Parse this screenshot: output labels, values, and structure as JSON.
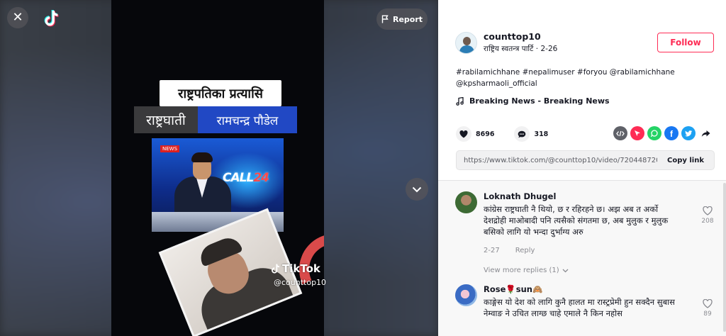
{
  "header": {
    "report_label": "Report"
  },
  "video": {
    "caption_line1": "राष्ट्रपतिका प्रत्यासि",
    "caption_word1": "राष्ट्रघाती",
    "caption_word2": "रामचन्द्र पौडेल",
    "news_call_text": "CALL",
    "news_call_accent": "24",
    "news_channel_chip": "NEWS",
    "watermark_brand": "TikTok",
    "watermark_handle": "@counttop10"
  },
  "author": {
    "username": "counttop10",
    "nickname": "राष्ट्रिय स्वतन्त्र पार्टि",
    "date": "2-26",
    "follow_label": "Follow"
  },
  "description": "#rabilamichhane #nepalimuser #foryou @rabilamichhane @kpsharmaoli_official",
  "music": {
    "title": "Breaking News - Breaking News"
  },
  "stats": {
    "likes": "8696",
    "comments": "318"
  },
  "share_icons": [
    "embed-icon",
    "send-icon",
    "whatsapp-icon",
    "facebook-icon",
    "twitter-icon",
    "share-arrow-icon"
  ],
  "link": {
    "url": "https://www.tiktok.com/@counttop10/video/72044872056...",
    "copy_label": "Copy link"
  },
  "comments": [
    {
      "name": "Loknath Dhugel",
      "text": "कांग्रेस राष्ट्रघाती नै थियो, छ र रहिरहने छ। अझ अब त अर्को देशद्रोही माओबादी पनि त्यसैको संगतमा छ, अब मुलुक र मुलुक बसिको लागि यो भन्दा दुर्भाग्य अरु",
      "date": "2-27",
      "reply_label": "Reply",
      "likes": "208",
      "view_more": "View more replies (1)"
    },
    {
      "name": "Rose🌹sun🙈",
      "text": "काङ्गेस यो देश को लागि कुनै हालत मा रास्ट्रप्रेमी हुन सक्दैन सुबास नेम्वाङ ने उचित लाग्छ चाहे एमाले नै किन नहोस",
      "likes": "89"
    }
  ],
  "colors": {
    "brand_red": "#fe2c55",
    "caption_blue": "#2148c4"
  }
}
